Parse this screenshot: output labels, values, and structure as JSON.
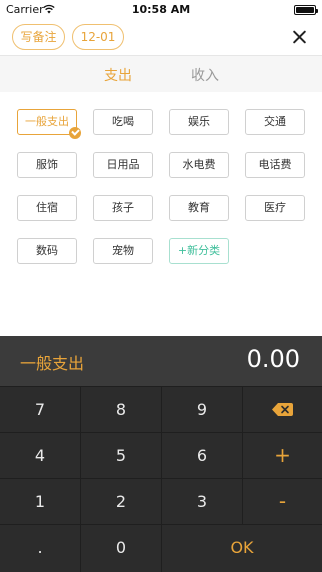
{
  "status_bar": {
    "carrier": "Carrier",
    "time": "10:58 AM"
  },
  "header": {
    "memo_label": "写备注",
    "date_label": "12-01"
  },
  "tabs": {
    "expense": "支出",
    "income": "收入"
  },
  "categories": [
    "一般支出",
    "吃喝",
    "娱乐",
    "交通",
    "服饰",
    "日用品",
    "水电费",
    "电话费",
    "住宿",
    "孩子",
    "教育",
    "医疗",
    "数码",
    "宠物",
    "+新分类"
  ],
  "selected_category": "一般支出",
  "amount": {
    "category": "一般支出",
    "value": "0.00"
  },
  "keypad": {
    "k7": "7",
    "k8": "8",
    "k9": "9",
    "k4": "4",
    "k5": "5",
    "k6": "6",
    "k1": "1",
    "k2": "2",
    "k3": "3",
    "dot": ".",
    "k0": "0",
    "plus": "+",
    "minus": "-",
    "ok": "OK"
  },
  "colors": {
    "accent": "#e8a43a",
    "add_category": "#3fbf9b",
    "keypad_bg": "#2c2c2c"
  }
}
